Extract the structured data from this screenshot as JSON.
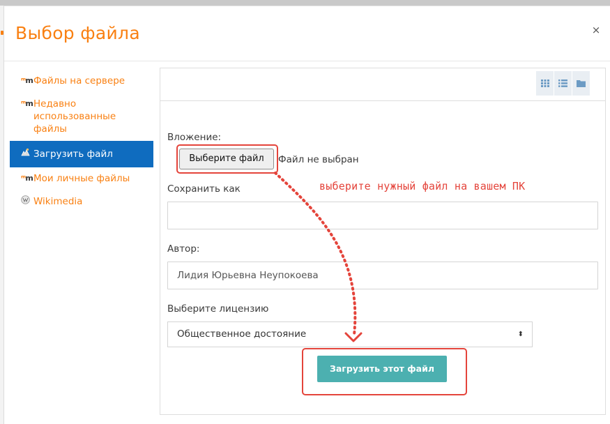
{
  "dialog": {
    "title": "Выбор файла",
    "close_label": "×"
  },
  "sidebar": {
    "items": [
      {
        "label": "Файлы на сервере",
        "icon": "moodle-icon",
        "active": false
      },
      {
        "label": "Недавно использованные файлы",
        "icon": "moodle-icon",
        "active": false
      },
      {
        "label": "Загрузить файл",
        "icon": "upload-icon",
        "active": true
      },
      {
        "label": "Мои личные файлы",
        "icon": "moodle-icon",
        "active": false
      },
      {
        "label": "Wikimedia",
        "icon": "wikimedia-icon",
        "active": false
      }
    ]
  },
  "toolbar": {
    "views": [
      "grid-view-icon",
      "list-view-icon",
      "folder-view-icon"
    ]
  },
  "form": {
    "attachment_label": "Вложение:",
    "choose_file_button": "Выберите файл",
    "no_file_text": "Файл не выбран",
    "save_as_label": "Сохранить как",
    "save_as_value": "",
    "author_label": "Автор:",
    "author_value": "Лидия Юрьевна Неупокоева",
    "license_label": "Выберите лицензию",
    "license_value": "Общественное достояние",
    "upload_button": "Загрузить этот файл"
  },
  "annotation": {
    "text": "выберите нужный файл на вашем ПК",
    "color": "#e4443b"
  },
  "colors": {
    "accent": "#f98012",
    "active_item": "#0f6cbf",
    "upload_button": "#4cb0b0"
  }
}
